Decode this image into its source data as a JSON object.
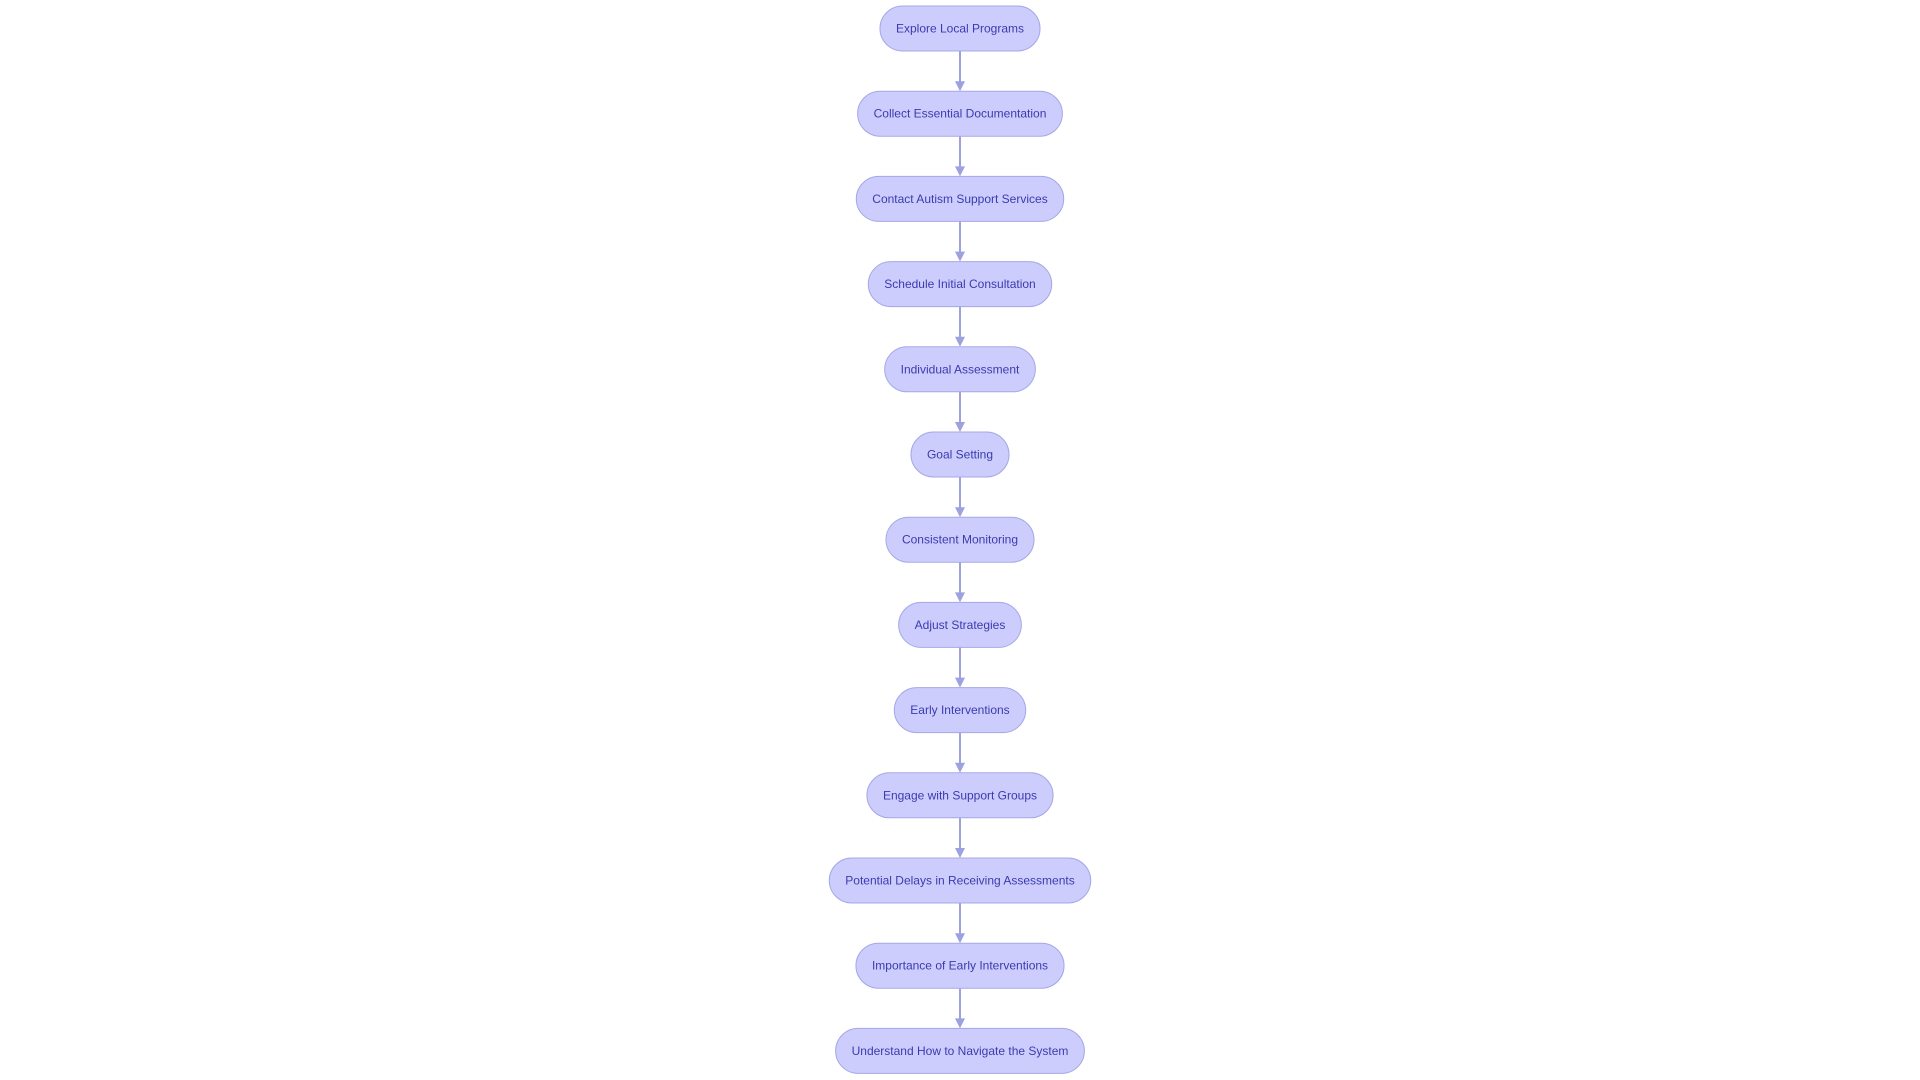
{
  "diagram": {
    "type": "flowchart",
    "direction": "top-to-bottom",
    "colors": {
      "node_fill": "#cdcdfd",
      "node_border": "#a5a8e6",
      "edge": "#9ea1e0",
      "text": "#3a3ab0"
    },
    "nodes": [
      {
        "id": "n1",
        "label": "Explore Local Programs"
      },
      {
        "id": "n2",
        "label": "Collect Essential Documentation"
      },
      {
        "id": "n3",
        "label": "Contact Autism Support Services"
      },
      {
        "id": "n4",
        "label": "Schedule Initial Consultation"
      },
      {
        "id": "n5",
        "label": "Individual Assessment"
      },
      {
        "id": "n6",
        "label": "Goal Setting"
      },
      {
        "id": "n7",
        "label": "Consistent Monitoring"
      },
      {
        "id": "n8",
        "label": "Adjust Strategies"
      },
      {
        "id": "n9",
        "label": "Early Interventions"
      },
      {
        "id": "n10",
        "label": "Engage with Support Groups"
      },
      {
        "id": "n11",
        "label": "Potential Delays in Receiving Assessments"
      },
      {
        "id": "n12",
        "label": "Importance of Early Interventions"
      },
      {
        "id": "n13",
        "label": "Understand How to Navigate the System"
      }
    ],
    "edges": [
      {
        "from": "n1",
        "to": "n2"
      },
      {
        "from": "n2",
        "to": "n3"
      },
      {
        "from": "n3",
        "to": "n4"
      },
      {
        "from": "n4",
        "to": "n5"
      },
      {
        "from": "n5",
        "to": "n6"
      },
      {
        "from": "n6",
        "to": "n7"
      },
      {
        "from": "n7",
        "to": "n8"
      },
      {
        "from": "n8",
        "to": "n9"
      },
      {
        "from": "n9",
        "to": "n10"
      },
      {
        "from": "n10",
        "to": "n11"
      },
      {
        "from": "n11",
        "to": "n12"
      },
      {
        "from": "n12",
        "to": "n13"
      }
    ]
  }
}
